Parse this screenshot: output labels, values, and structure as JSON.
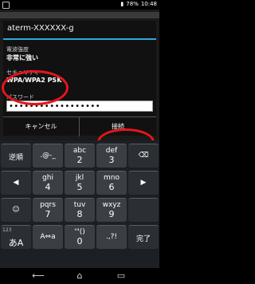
{
  "status_bar": {
    "signal": "▮",
    "battery": "78%",
    "time": "10:48"
  },
  "dialog": {
    "title": "aterm-XXXXXX-g",
    "signal_label": "電波強度",
    "signal_value": "非常に強い",
    "security_label": "セキュリティ",
    "security_value": "WPA/WPA2 PSK",
    "password_label": "パスワード",
    "password_value": "••••••••••••••••••",
    "cancel_label": "キャンセル",
    "connect_label": "接続"
  },
  "keyboard": {
    "row1": [
      {
        "main": "逆順"
      },
      {
        "main": ".@-_",
        "sub": ""
      },
      {
        "main": "abc",
        "sub": "2"
      },
      {
        "main": "def",
        "sub": "3"
      },
      {
        "main": "⌫"
      }
    ],
    "row2": [
      {
        "main": "◀"
      },
      {
        "main": "ghi",
        "sub": "4"
      },
      {
        "main": "jkl",
        "sub": "5"
      },
      {
        "main": "mno",
        "sub": "6"
      },
      {
        "main": "▶"
      }
    ],
    "row3": [
      {
        "main": "☺"
      },
      {
        "main": "pqrs",
        "sub": "7"
      },
      {
        "main": "tuv",
        "sub": "8"
      },
      {
        "main": "wxyz",
        "sub": "9"
      },
      {
        "main": ""
      }
    ],
    "row4": [
      {
        "main": "あA",
        "tiny": "123"
      },
      {
        "main": "A⇔a"
      },
      {
        "main": "'\"()",
        "sub": "0"
      },
      {
        "main": ".,?!"
      },
      {
        "main": "完了"
      }
    ]
  },
  "navigation": {
    "back": "⟵",
    "home": "⌂",
    "recent": "▭"
  }
}
